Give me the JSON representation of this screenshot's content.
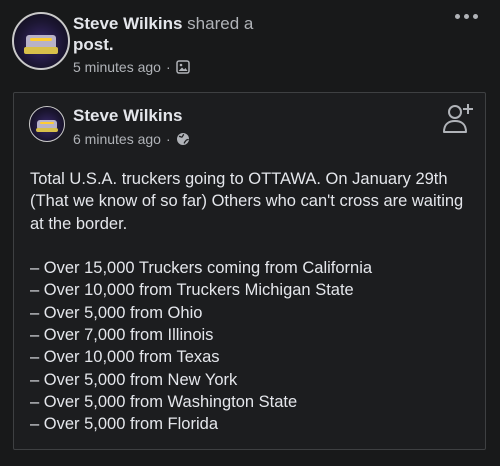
{
  "share_header": {
    "author_name": "Steve Wilkins",
    "action_text": " shared a",
    "action_text_2": "post.",
    "timestamp": "5 minutes ago",
    "separator": "·",
    "audience_icon": "photo-icon"
  },
  "original_post": {
    "author_name": "Steve Wilkins",
    "timestamp": "6 minutes ago",
    "separator": "·",
    "audience_icon": "globe-icon",
    "intro": "Total U.S.A. truckers going to OTTAWA. On January 29th (That we know of so far) Others who can't cross are waiting at the border.",
    "items": [
      "– Over 15,000 Truckers coming from California",
      "– Over 10,000 from Truckers Michigan State",
      "– Over 5,000 from Ohio",
      "– Over 7,000 from Illinois",
      "– Over 10,000 from Texas",
      "– Over 5,000 from New York",
      "– Over 5,000 from Washington State",
      "– Over 5,000 from Florida"
    ]
  },
  "colors": {
    "background": "#18191a",
    "text": "#e4e6eb",
    "muted": "#b0b3b8",
    "card_border": "#3e4042"
  }
}
